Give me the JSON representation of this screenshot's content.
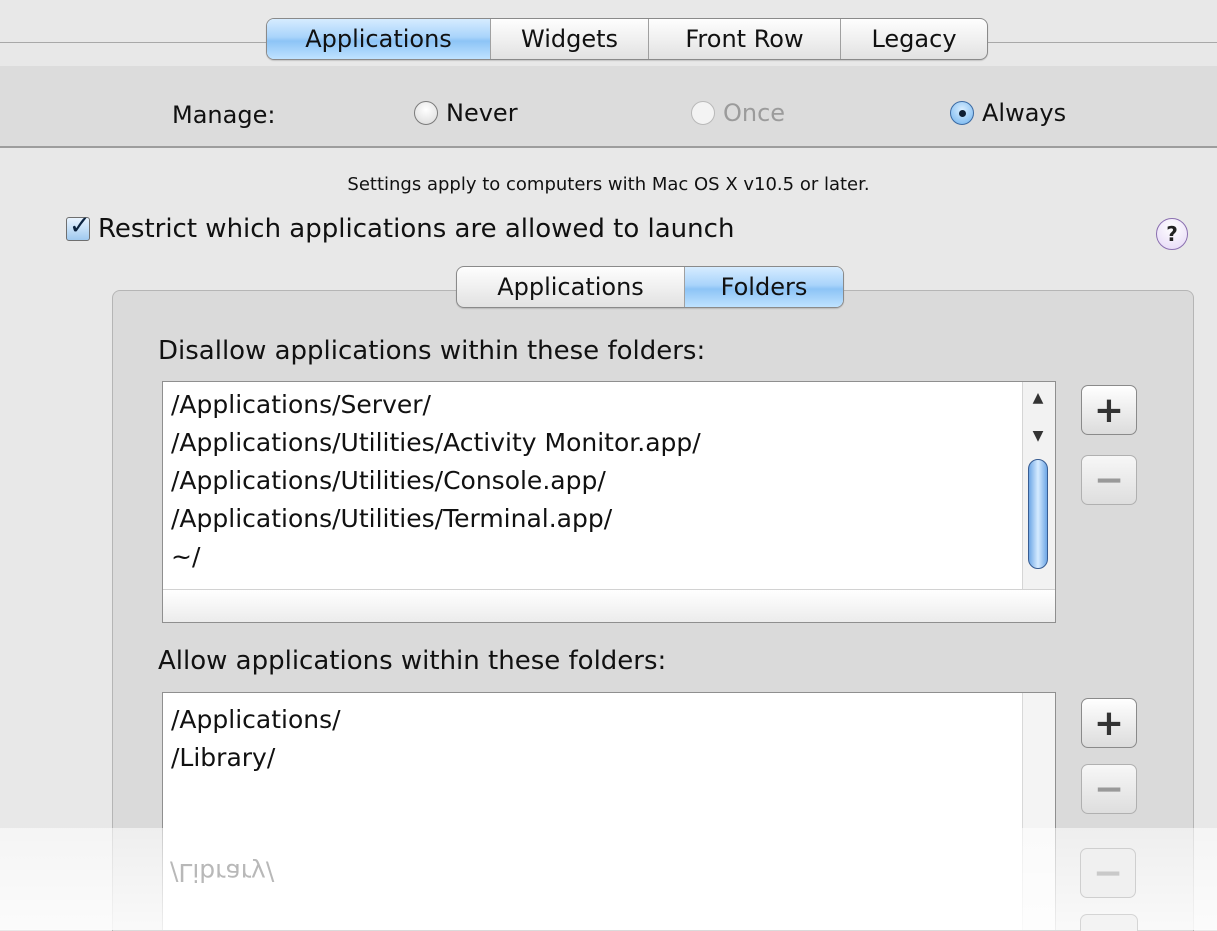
{
  "top_tabs": [
    {
      "label": "Applications",
      "selected": true
    },
    {
      "label": "Widgets",
      "selected": false
    },
    {
      "label": "Front Row",
      "selected": false
    },
    {
      "label": "Legacy",
      "selected": false
    }
  ],
  "manage": {
    "label": "Manage:",
    "options": [
      {
        "label": "Never",
        "state": "off"
      },
      {
        "label": "Once",
        "state": "disabled"
      },
      {
        "label": "Always",
        "state": "on"
      }
    ]
  },
  "settings_note": "Settings apply to computers with Mac OS X v10.5 or later.",
  "restrict": {
    "label": "Restrict which applications are allowed to launch",
    "checked": true
  },
  "help_icon": "?",
  "sub_tabs": [
    {
      "label": "Applications",
      "selected": false
    },
    {
      "label": "Folders",
      "selected": true
    }
  ],
  "disallow": {
    "label": "Disallow applications within these folders:",
    "items": [
      "/Applications/Server/",
      "/Applications/Utilities/Activity Monitor.app/",
      "/Applications/Utilities/Console.app/",
      "/Applications/Utilities/Terminal.app/",
      "~/"
    ]
  },
  "allow": {
    "label": "Allow applications within these folders:",
    "items": [
      "/Applications/",
      "/Library/"
    ]
  },
  "buttons": {
    "add": "+",
    "remove": "−"
  },
  "reflection_text": "/Library/"
}
